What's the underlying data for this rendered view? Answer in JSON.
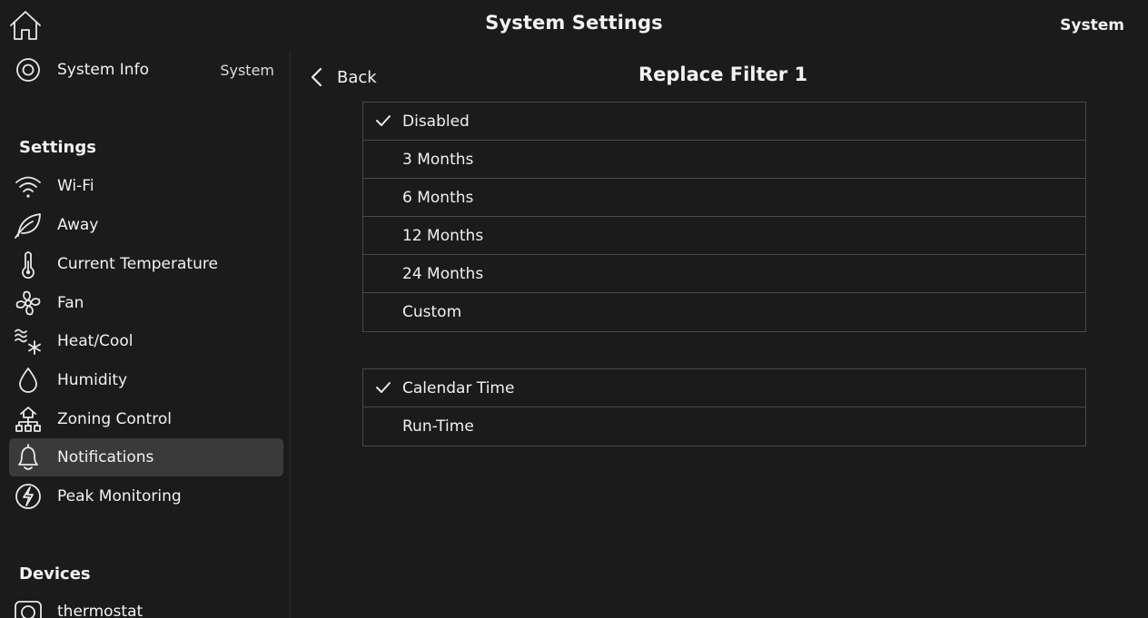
{
  "header": {
    "title": "System Settings",
    "right_label": "System"
  },
  "sidebar": {
    "system_info": {
      "label": "System Info",
      "right": "System"
    },
    "settings_header": "Settings",
    "items": [
      {
        "label": "Wi-Fi",
        "icon": "wifi-icon"
      },
      {
        "label": "Away",
        "icon": "leaf-icon"
      },
      {
        "label": "Current Temperature",
        "icon": "thermometer-icon"
      },
      {
        "label": "Fan",
        "icon": "fan-icon"
      },
      {
        "label": "Heat/Cool",
        "icon": "heat-cool-icon"
      },
      {
        "label": "Humidity",
        "icon": "droplet-icon"
      },
      {
        "label": "Zoning Control",
        "icon": "zoning-icon"
      },
      {
        "label": "Notifications",
        "icon": "bell-icon",
        "active": true
      },
      {
        "label": "Peak Monitoring",
        "icon": "lightning-icon"
      }
    ],
    "devices_header": "Devices",
    "devices": [
      {
        "label": "thermostat",
        "icon": "thermostat-icon"
      }
    ]
  },
  "main": {
    "back_label": "Back",
    "title": "Replace Filter 1",
    "interval_options": [
      {
        "label": "Disabled",
        "selected": true
      },
      {
        "label": "3 Months",
        "selected": false
      },
      {
        "label": "6 Months",
        "selected": false
      },
      {
        "label": "12 Months",
        "selected": false
      },
      {
        "label": "24 Months",
        "selected": false
      },
      {
        "label": "Custom",
        "selected": false
      }
    ],
    "time_options": [
      {
        "label": "Calendar Time",
        "selected": true
      },
      {
        "label": "Run-Time",
        "selected": false
      }
    ]
  },
  "colors": {
    "background": "#1b1b1b",
    "active_item": "#3a3a3a",
    "border": "#4a4a4a",
    "text": "#f2f2f2"
  }
}
